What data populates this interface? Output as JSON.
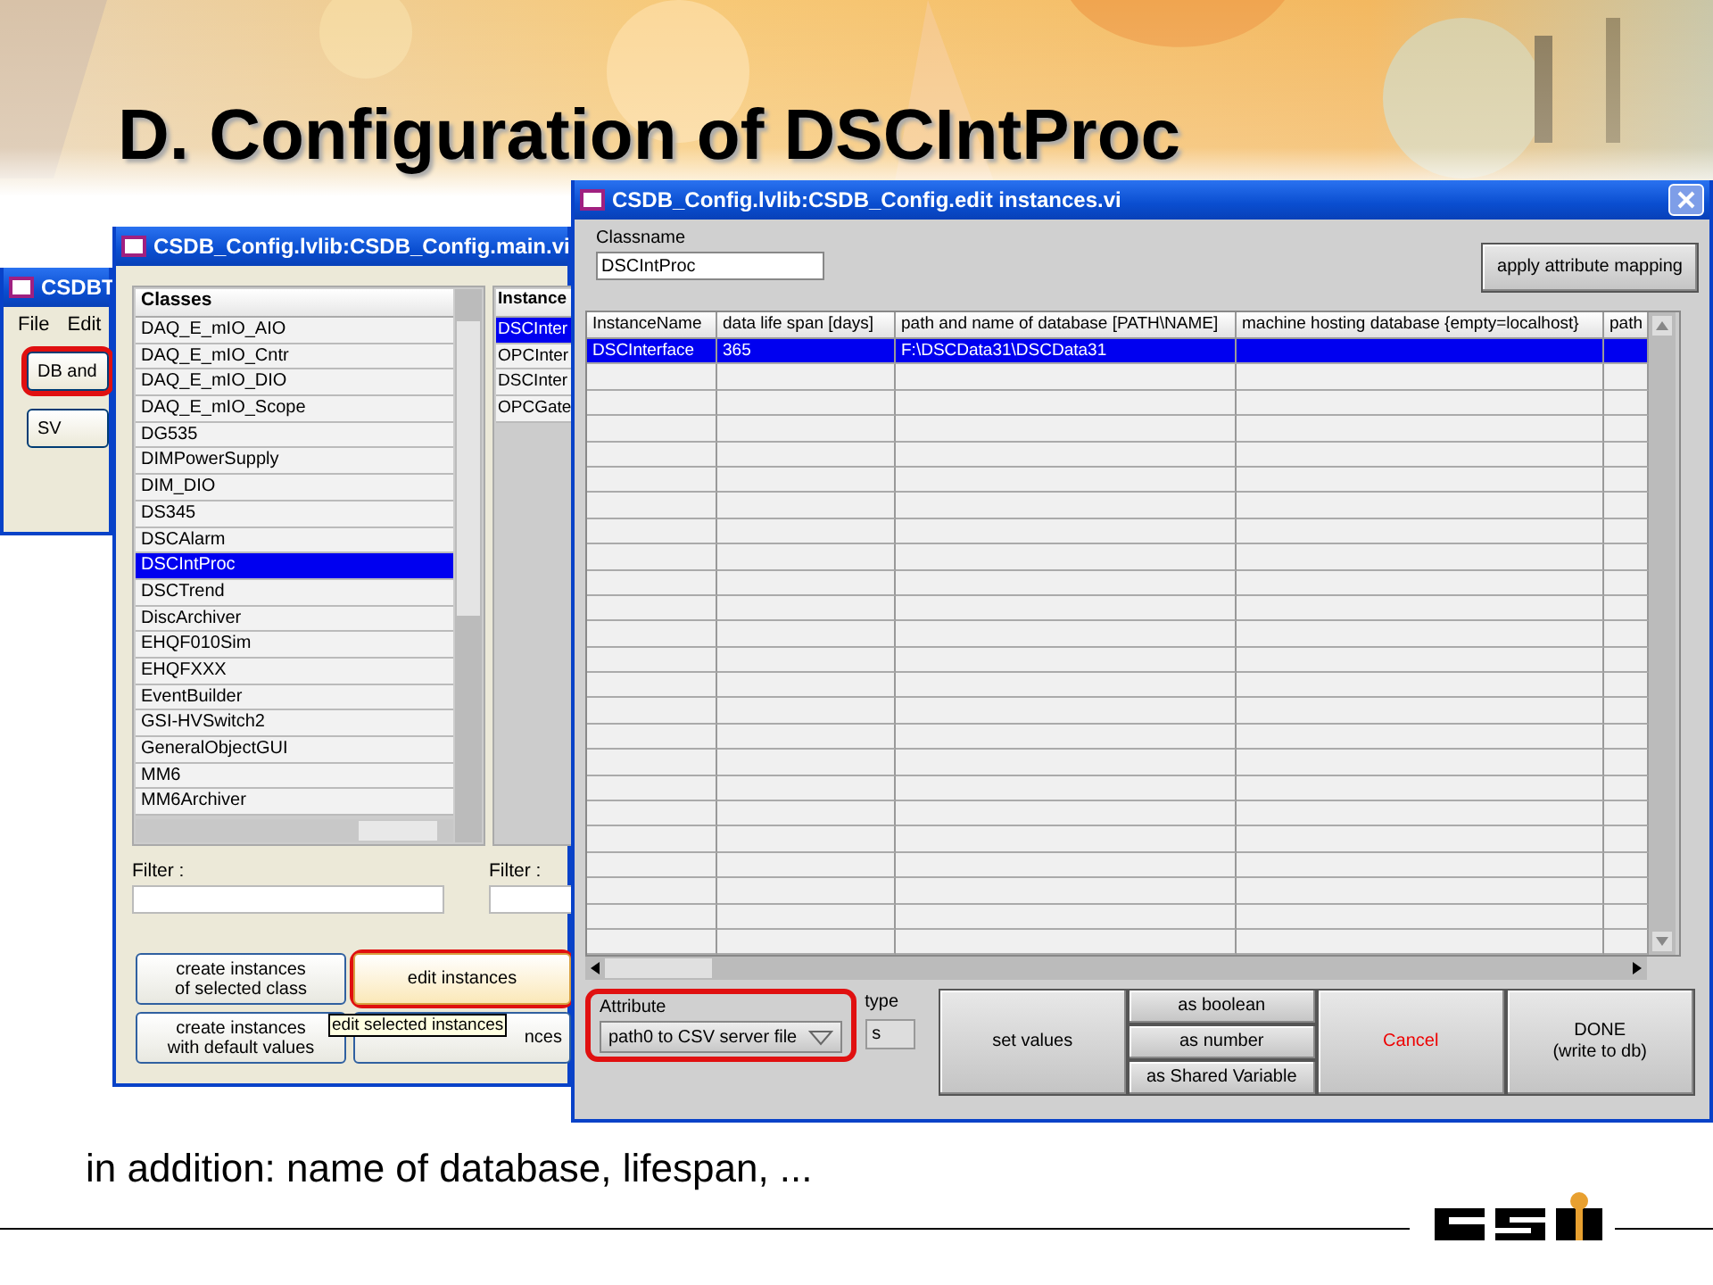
{
  "slide": {
    "title": "D. Configuration of DSCIntProc",
    "footer": "in addition: name of database, lifespan, ..."
  },
  "back_window": {
    "title": "CSDBT",
    "menu": [
      "File",
      "Edit"
    ],
    "buttons": [
      {
        "label": "DB and",
        "highlighted": true
      },
      {
        "label": "SV",
        "highlighted": false
      }
    ]
  },
  "main_window": {
    "title": "CSDB_Config.lvlib:CSDB_Config.main.vi",
    "classes": {
      "header": "Classes",
      "items": [
        {
          "label": "DAQ_E_mIO_AIO",
          "selected": false
        },
        {
          "label": "DAQ_E_mIO_Cntr",
          "selected": false
        },
        {
          "label": "DAQ_E_mIO_DIO",
          "selected": false
        },
        {
          "label": "DAQ_E_mIO_Scope",
          "selected": false
        },
        {
          "label": "DG535",
          "selected": false
        },
        {
          "label": "DIMPowerSupply",
          "selected": false
        },
        {
          "label": "DIM_DIO",
          "selected": false
        },
        {
          "label": "DS345",
          "selected": false
        },
        {
          "label": "DSCAlarm",
          "selected": false
        },
        {
          "label": "DSCIntProc",
          "selected": true
        },
        {
          "label": "DSCTrend",
          "selected": false
        },
        {
          "label": "DiscArchiver",
          "selected": false
        },
        {
          "label": "EHQF010Sim",
          "selected": false
        },
        {
          "label": "EHQFXXX",
          "selected": false
        },
        {
          "label": "EventBuilder",
          "selected": false
        },
        {
          "label": "GSI-HVSwitch2",
          "selected": false
        },
        {
          "label": "GeneralObjectGUI",
          "selected": false
        },
        {
          "label": "MM6",
          "selected": false
        },
        {
          "label": "MM6Archiver",
          "selected": false
        }
      ]
    },
    "instances": {
      "header": "Instance",
      "items": [
        {
          "label": "DSCInter",
          "selected": true
        },
        {
          "label": "OPCInter",
          "selected": false
        },
        {
          "label": "DSCInter",
          "selected": false
        },
        {
          "label": "OPCGate",
          "selected": false
        }
      ]
    },
    "filters": [
      {
        "label": "Filter :"
      },
      {
        "label": "Filter :"
      }
    ],
    "buttons": [
      {
        "label": "create instances\nof selected class",
        "highlighted": false,
        "hovered": false
      },
      {
        "label": "edit instances",
        "highlighted": true,
        "hovered": true
      },
      {
        "label": "create instances\nwith default values",
        "highlighted": false,
        "hovered": false
      },
      {
        "label": "nces",
        "highlighted": false,
        "hovered": false
      }
    ],
    "tooltip": "edit selected instances"
  },
  "edit_window": {
    "title": "CSDB_Config.lvlib:CSDB_Config.edit instances.vi",
    "classname": {
      "label": "Classname",
      "value": "DSCIntProc"
    },
    "apply_button": "apply attribute mapping",
    "table": {
      "columns": [
        "InstanceName",
        "data life span [days]",
        "path and name of database [PATH\\NAME]",
        "machine hosting database {empty=localhost}",
        "path"
      ],
      "rows": [
        {
          "cells": [
            "DSCInterface",
            "365",
            "F:\\DSCData31\\DSCData31"
          ],
          "selected": true
        }
      ]
    },
    "attribute": {
      "label": "Attribute",
      "value": "path0 to CSV server file",
      "highlighted": true
    },
    "type": {
      "label": "type",
      "value": "s"
    },
    "buttons": [
      {
        "label": "set values",
        "kind": "large"
      },
      {
        "label": "as boolean",
        "kind": "small"
      },
      {
        "label": "as number",
        "kind": "small"
      },
      {
        "label": "as Shared Variable",
        "kind": "small"
      },
      {
        "label": "Cancel",
        "kind": "cancel"
      },
      {
        "label": "DONE\n(write to db)",
        "kind": "large"
      }
    ]
  }
}
